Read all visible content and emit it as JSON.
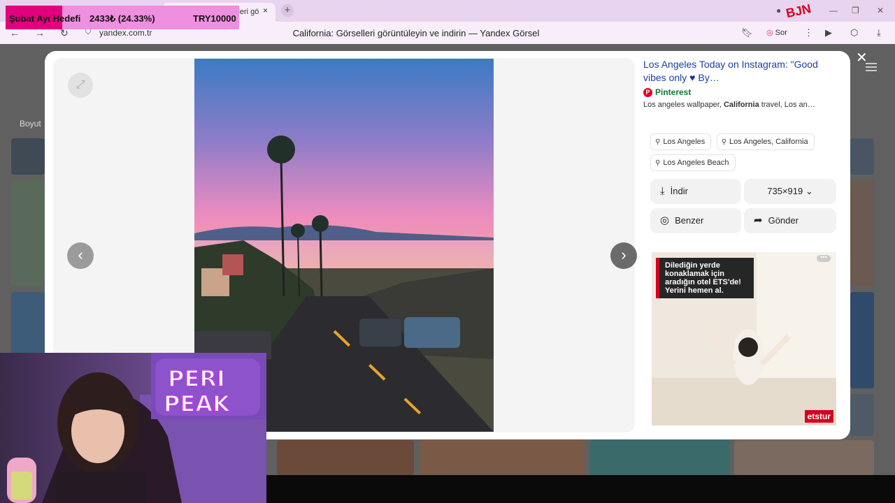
{
  "browser": {
    "tab_title": "lleri gö",
    "tab_close": "×",
    "new_tab": "+",
    "url": "yandex.com.tr",
    "page_title": "California: Görselleri görüntüleyin ve indirin — Yandex Görsel",
    "sor_label": "Sor"
  },
  "overlay": {
    "goal_label": "Şubat Ayı Hedefi",
    "goal_value": "2433₺ (24.33%)",
    "goal_target": "TRY10000",
    "goal_progress": 0.2433,
    "logo_text": "BJN"
  },
  "background": {
    "filter_label": "Boyut"
  },
  "viewer": {
    "expand_icon": "⤢",
    "prev_icon": "‹",
    "next_icon": "›",
    "close_icon": "✕"
  },
  "result": {
    "title": "Los Angeles Today on Instagram: \"Good vibes only",
    "title_heart": "♥",
    "title_end": " By…",
    "source": "Pinterest",
    "source_icon": "P",
    "desc_start": "Los angeles wallpaper, ",
    "desc_bold": "California",
    "desc_end": " travel, Los an…"
  },
  "chips": [
    {
      "label": "Los Angeles"
    },
    {
      "label": "Los Angeles, California"
    },
    {
      "label": "Los Angeles Beach"
    }
  ],
  "actions": {
    "download": "İndir",
    "size": "735×919",
    "similar": "Benzer",
    "share": "Gönder"
  },
  "ad": {
    "text": "Dilediğin yerde konaklamak için aradığın otel ETS'de! Yerini hemen al.",
    "more": "•••",
    "logo": "etstur"
  },
  "webcam": {
    "sign_line1": "PERI",
    "sign_line2": "PEAK"
  },
  "colors": {
    "link": "#1a3ea8",
    "source_green": "#0a7a32",
    "pinterest_red": "#e60023",
    "goal_fill": "#e3007d"
  }
}
